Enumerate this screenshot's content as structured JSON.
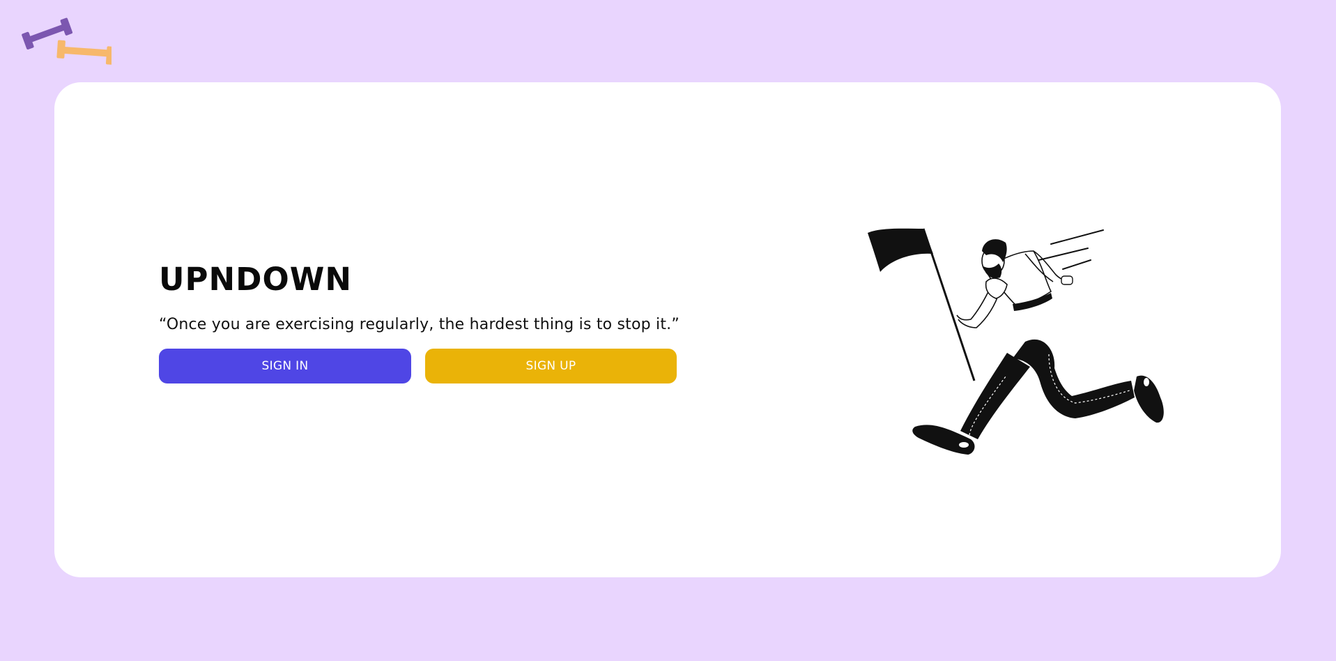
{
  "brand": {
    "logo_icon": "dumbbells-icon",
    "title": "UPNDOWN"
  },
  "hero": {
    "quote": "“Once you are exercising regularly, the hardest thing is to stop it.”",
    "illustration": "running-man-with-flag-illustration"
  },
  "actions": {
    "sign_in_label": "SIGN IN",
    "sign_up_label": "SIGN UP"
  },
  "colors": {
    "page_background": "#e9d5fe",
    "card_background": "#ffffff",
    "sign_in_button": "#4f46e5",
    "sign_up_button": "#eab308",
    "logo_purple": "#7c57b0",
    "logo_orange": "#f7b86b"
  }
}
